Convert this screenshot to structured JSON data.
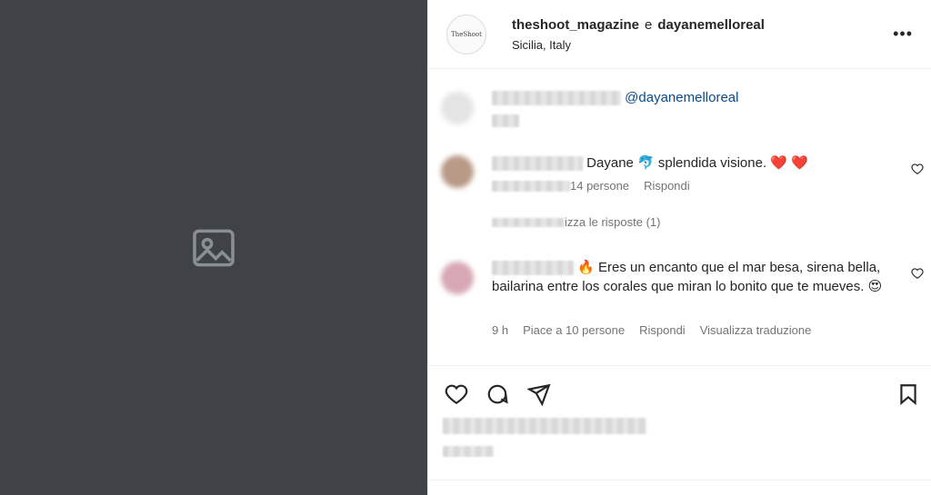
{
  "media": {
    "placeholder_icon": "image-icon"
  },
  "header": {
    "avatar_text": "TheShoot",
    "user1": "theshoot_magazine",
    "conjunction": "e",
    "user2": "dayanemelloreal",
    "location": "Sicilia, Italy",
    "more_label": "•••"
  },
  "caption": {
    "mention": "@dayanemelloreal"
  },
  "comments": [
    {
      "text": "Dayane 🐬 splendida visione. ❤️ ❤️",
      "meta_likes": "14 persone",
      "meta_reply": "Rispondi",
      "replies_label": "izza le risposte (1)"
    },
    {
      "text": "🔥 Eres un encanto que el mar besa, sirena bella, bailarina entre los corales que miran lo bonito que te mueves.",
      "emoji": "😍",
      "meta_time": "9 h",
      "meta_likes": "Piace a 10 persone",
      "meta_reply": "Rispondi",
      "meta_translate": "Visualizza traduzione"
    }
  ],
  "icons": {
    "like": "heart-icon",
    "comment": "comment-icon",
    "share": "send-icon",
    "save": "bookmark-icon"
  }
}
